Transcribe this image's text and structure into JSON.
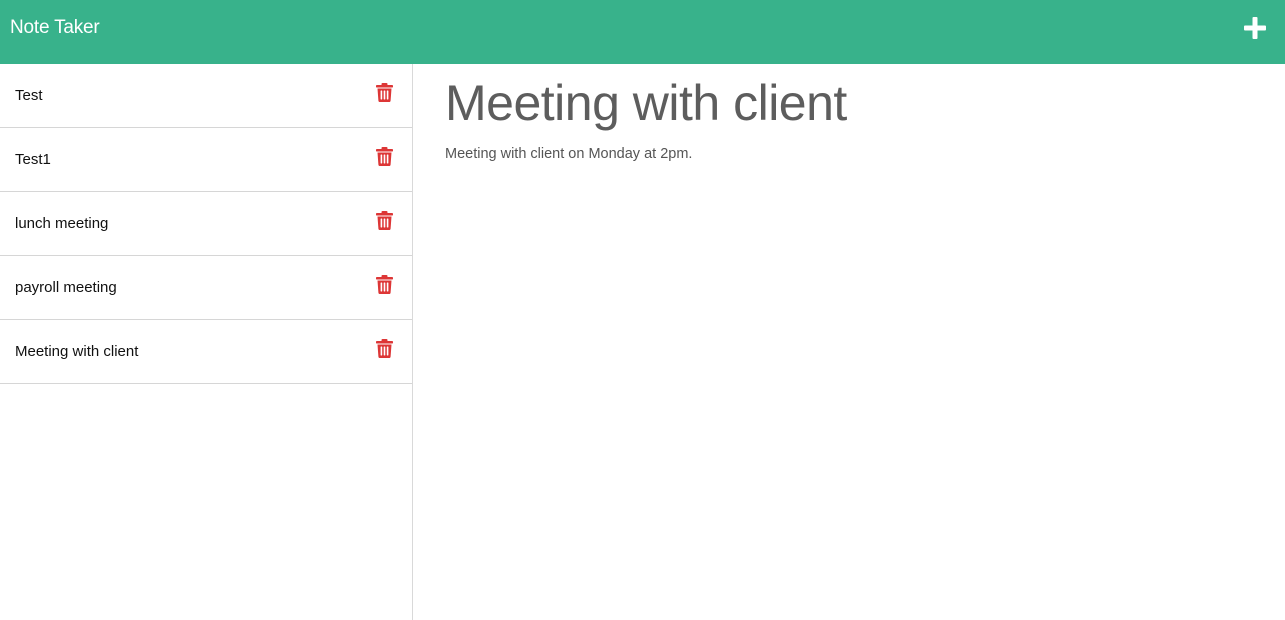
{
  "app": {
    "brand": "Note Taker",
    "colors": {
      "navbar": "#38b28b",
      "delete_icon": "#dd3636",
      "title_text": "#5d5d5d"
    },
    "icons": {
      "new_note": "plus-icon",
      "delete": "trash-icon"
    }
  },
  "notes": [
    {
      "title": "Test"
    },
    {
      "title": "Test1"
    },
    {
      "title": "lunch meeting"
    },
    {
      "title": "payroll meeting"
    },
    {
      "title": "Meeting with client"
    }
  ],
  "active_note": {
    "title": "Meeting with client",
    "text": "Meeting with client on Monday at 2pm."
  }
}
